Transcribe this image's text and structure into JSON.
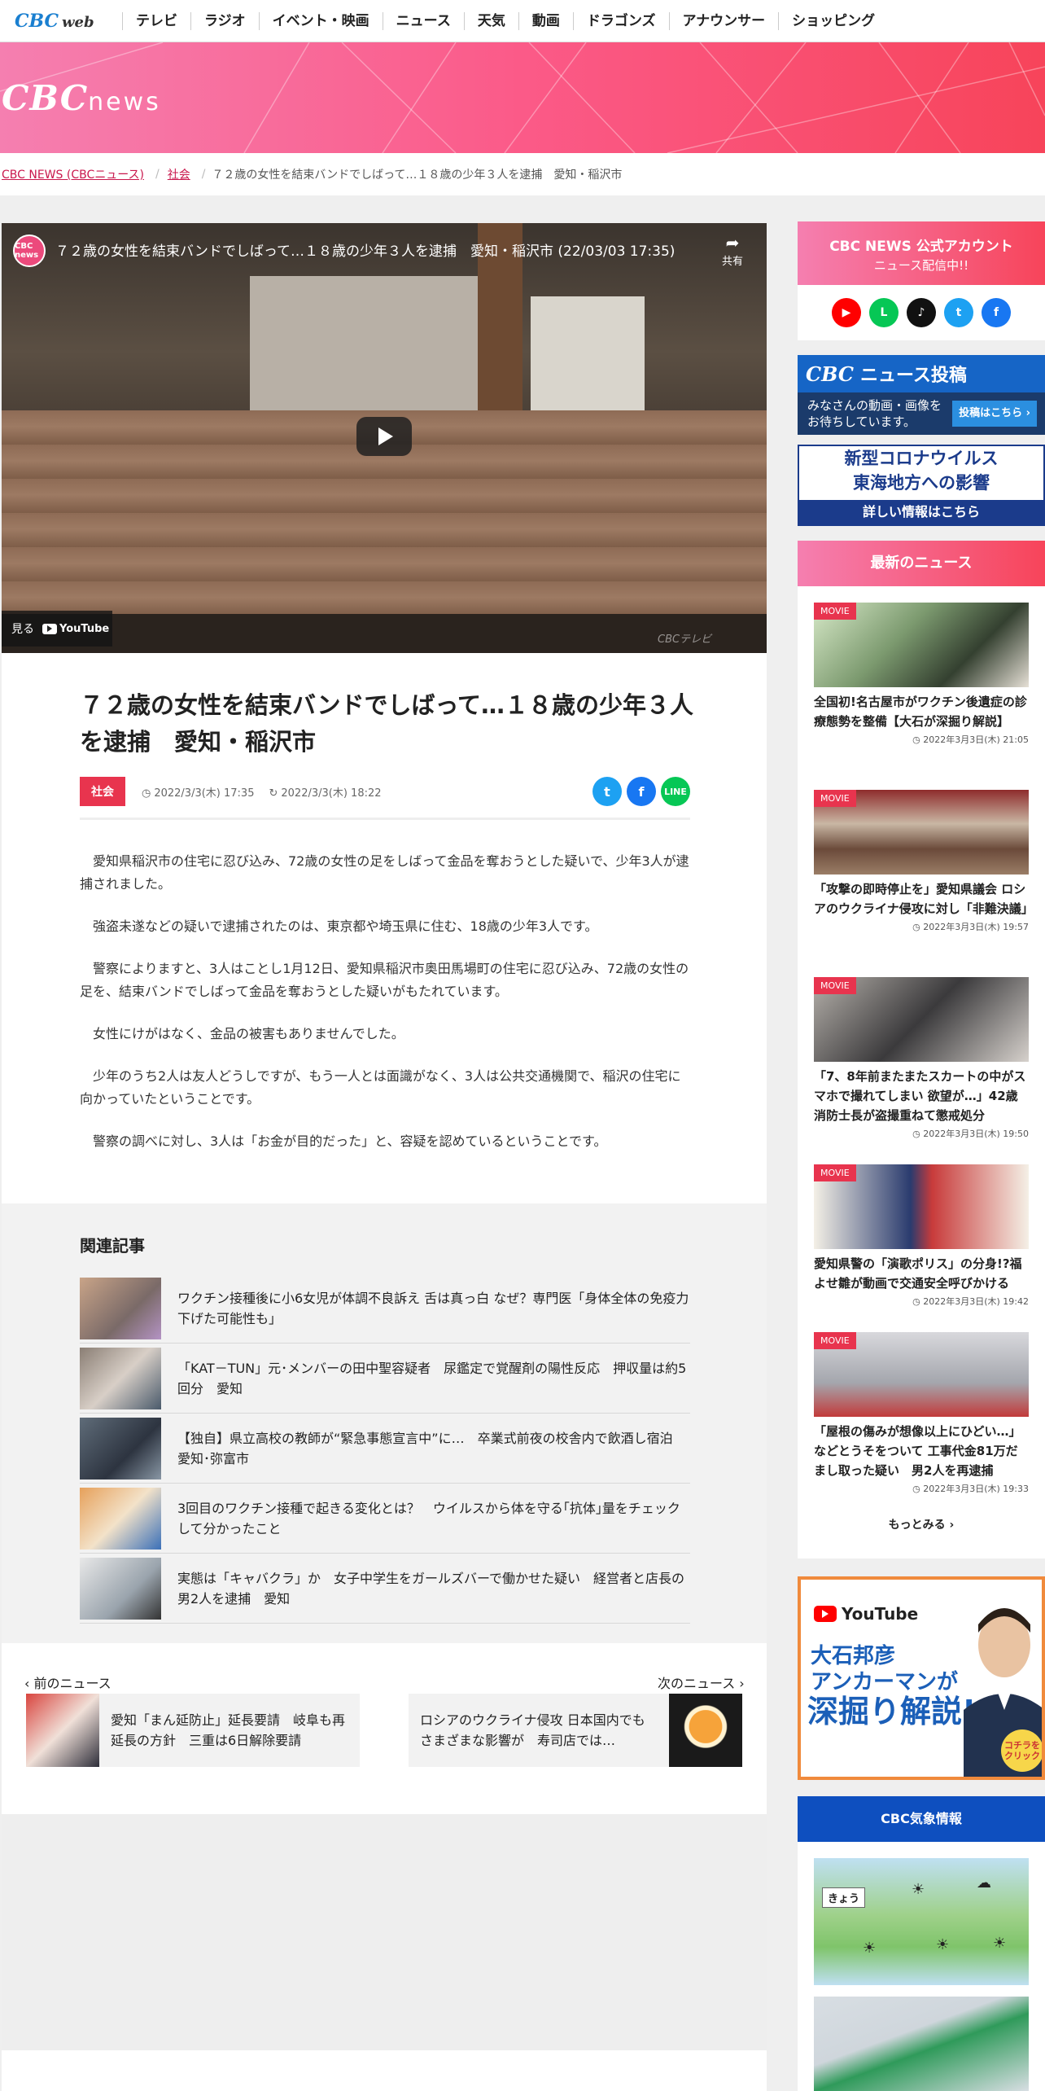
{
  "topnav": {
    "logo_cbc": "CBC",
    "logo_web": "web",
    "items": [
      "テレビ",
      "ラジオ",
      "イベント・映画",
      "ニュース",
      "天気",
      "動画",
      "ドラゴンズ",
      "アナウンサー",
      "ショッピング"
    ]
  },
  "hero": {
    "logo_cbc": "CBC",
    "logo_news": "news"
  },
  "breadcrumb": {
    "home": "CBC NEWS (CBCニュース)",
    "category": "社会",
    "current": "７２歳の女性を結束バンドでしばって…１８歳の少年３人を逮捕　愛知・稲沢市"
  },
  "video": {
    "channel_label": "CBC news",
    "title": "７２歳の女性を結束バンドでしばって…１８歳の少年３人を逮捕　愛知・稲沢市 (22/03/03 17:35)",
    "share_label": "共有",
    "watch_label": "見る",
    "youtube_label": "YouTube",
    "watermark": "CBCテレビ"
  },
  "article": {
    "title": "７２歳の女性を結束バンドでしばって…１８歳の少年３人を逮捕　愛知・稲沢市",
    "category": "社会",
    "published": "2022/3/3(木) 17:35",
    "updated": "2022/3/3(木) 18:22",
    "paragraphs": [
      "愛知県稲沢市の住宅に忍び込み、72歳の女性の足をしばって金品を奪おうとした疑いで、少年3人が逮捕されました。",
      "強盗未遂などの疑いで逮捕されたのは、東京都や埼玉県に住む、18歳の少年3人です。",
      "警察によりますと、3人はことし1月12日、愛知県稲沢市奥田馬場町の住宅に忍び込み、72歳の女性の足を、結束バンドでしばって金品を奪おうとした疑いがもたれています。",
      "女性にけがはなく、金品の被害もありませんでした。",
      "少年のうち2人は友人どうしですが、もう一人とは面識がなく、3人は公共交通機関で、稲沢の住宅に向かっていたということです。",
      "警察の調べに対し、3人は「お金が目的だった」と、容疑を認めているということです。"
    ]
  },
  "related": {
    "heading": "関連記事",
    "items": [
      "ワクチン接種後に小6女児が体調不良訴え 舌は真っ白 なぜ？専門医「身体全体の免疫力下げた可能性も」",
      "「KAT－TUN」元･メンバーの田中聖容疑者　尿鑑定で覚醒剤の陽性反応　押収量は約5回分　愛知",
      "【独自】県立高校の教師が“緊急事態宣言中”に…　卒業式前夜の校舎内で飲酒し宿泊　愛知･弥富市",
      "3回目のワクチン接種で起きる変化とは？　ウイルスから体を守る｢抗体｣量をチェックして分かったこと",
      "実態は「キャバクラ」か　女子中学生をガールズバーで働かせた疑い　経営者と店長の男2人を逮捕　愛知"
    ]
  },
  "pager": {
    "prev_label": "前のニュース",
    "next_label": "次のニュース",
    "prev_title": "愛知「まん延防止」延長要請　岐阜も再延長の方針　三重は6日解除要請",
    "next_title": "ロシアのウクライナ侵攻 日本国内でもさまざまな影響が　寿司店では…"
  },
  "sidebar": {
    "official_title": "CBC NEWS 公式アカウント",
    "official_sub": "ニュース配信中!!",
    "social": [
      {
        "icon": "youtube-icon",
        "color": "#ff0000",
        "glyph": "▶"
      },
      {
        "icon": "line-icon",
        "color": "#06c755",
        "glyph": "L"
      },
      {
        "icon": "tiktok-icon",
        "color": "#111111",
        "glyph": "♪"
      },
      {
        "icon": "twitter-icon",
        "color": "#1da1f2",
        "glyph": "t"
      },
      {
        "icon": "facebook-icon",
        "color": "#1877f2",
        "glyph": "f"
      }
    ],
    "post_logo": "CBC",
    "post_title": "ニュース投稿",
    "post_text_1": "みなさんの動画・画像を",
    "post_text_2": "お待ちしています。",
    "post_button": "投稿はこちら ›",
    "covid_1": "新型コロナウイルス",
    "covid_2": "東海地方への影響",
    "covid_3": "詳しい情報はこちら",
    "latest_heading": "最新のニュース",
    "movie_tag": "MOVIE",
    "news": [
      {
        "title": "全国初!名古屋市がワクチン後遺症の診療態勢を整備【大石が深掘り解説】",
        "date": "2022年3月3日(木) 21:05"
      },
      {
        "title": "「攻撃の即時停止を」愛知県議会 ロシアのウクライナ侵攻に対し「非難決議」",
        "date": "2022年3月3日(木) 19:57"
      },
      {
        "title": "「7、8年前またまたスカートの中がスマホで撮れてしまい 欲望が…」42歳消防士長が盗撮重ねて懲戒処分",
        "date": "2022年3月3日(木) 19:50"
      },
      {
        "title": "愛知県警の「演歌ポリス」の分身!?福よせ雛が動画で交通安全呼びかける",
        "date": "2022年3月3日(木) 19:42"
      },
      {
        "title": "「屋根の傷みが想像以上にひどい…」などとうそをついて 工事代金81万だまし取った疑い　男2人を再逮捕",
        "date": "2022年3月3日(木) 19:33"
      }
    ],
    "more_label": "もっとみる ›",
    "yt_logo": "YouTube",
    "yt_line1": "大石邦彦",
    "yt_line2": "アンカーマンが",
    "yt_line3": "深掘り解説!",
    "yt_click": "コチラをクリック",
    "weather_heading": "CBC気象情報",
    "weather_today": "きょう"
  }
}
